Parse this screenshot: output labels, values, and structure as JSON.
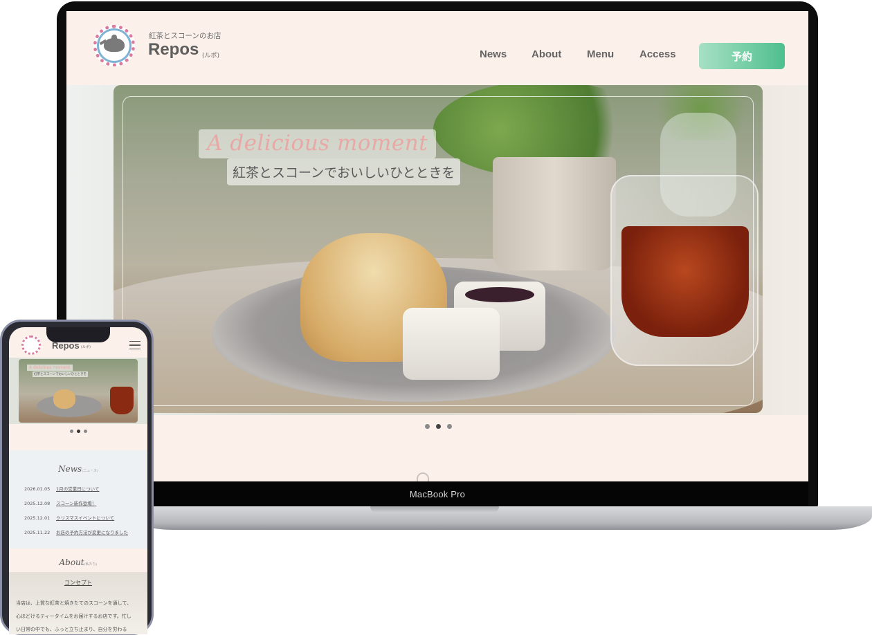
{
  "laptop": {
    "brand_label": "MacBook Pro"
  },
  "site": {
    "brand_sub": "紅茶とスコーンのお店",
    "brand_name": "Repos",
    "brand_kana": "(ルポ)",
    "nav": [
      {
        "label": "News"
      },
      {
        "label": "About"
      },
      {
        "label": "Menu"
      },
      {
        "label": "Access"
      }
    ],
    "reserve_label": "予約",
    "hero_title": "A delicious moment",
    "hero_subtitle": "紅茶とスコーンでおいしいひとときを",
    "carousel": {
      "count": 3,
      "active_index": 1
    },
    "accent_color": "#4fbf8e",
    "background_color": "#fcf0ea"
  },
  "phone": {
    "brand_name": "Repos",
    "brand_kana": "(ルポ)",
    "hero_title": "A delicious moment",
    "hero_subtitle": "紅茶とスコーンでおいしいひとときを",
    "news": {
      "title": "News",
      "title_kana": "(ニュース)",
      "items": [
        {
          "date": "2026.01.05",
          "text": "1月の営業日について"
        },
        {
          "date": "2025.12.08",
          "text": "スコーン新作登場！"
        },
        {
          "date": "2025.12.01",
          "text": "クリスマスイベントについて"
        },
        {
          "date": "2025.11.22",
          "text": "お店の予約方法が変更になりました"
        }
      ]
    },
    "about": {
      "title": "About",
      "title_kana": "(私たち)",
      "concept_label": "コンセプト",
      "lines": [
        "当店は、上質な紅茶と焼きたてのスコーンを通して、",
        "心ほどけるティータイムをお届けするお店です。忙し",
        "い日常の中でも、ふっと立ち止まり、自分を労わる"
      ]
    }
  }
}
